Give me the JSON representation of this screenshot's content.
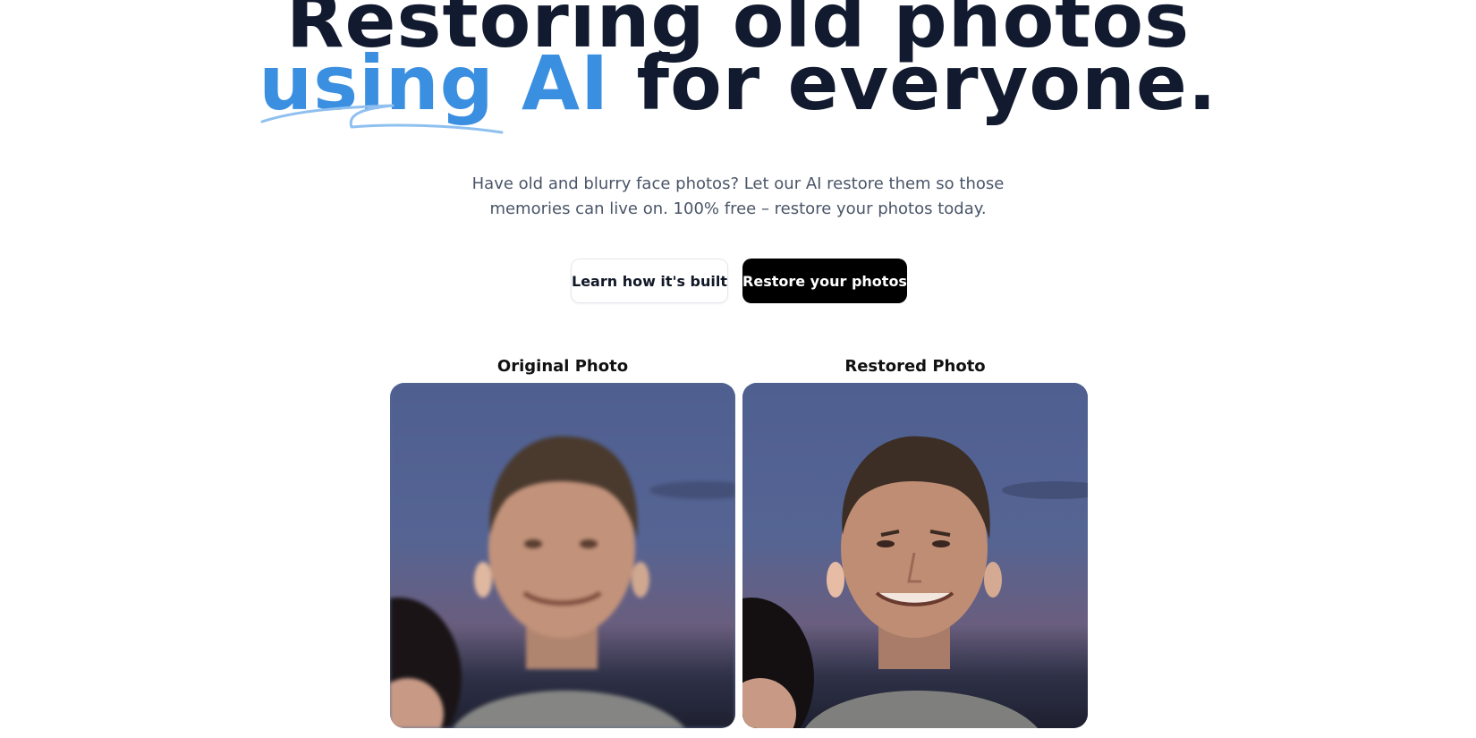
{
  "hero": {
    "title_line1": "Restoring old photos",
    "title_accent": "using AI",
    "title_rest": " for everyone.",
    "accent_color": "#3b8fe0",
    "subtitle": "Have old and blurry face photos? Let our AI restore them so those memories can live on. 100% free – restore your photos today."
  },
  "actions": {
    "learn_label": "Learn how it's built",
    "restore_label": "Restore your photos"
  },
  "comparison": {
    "original_label": "Original Photo",
    "restored_label": "Restored Photo",
    "original_image": "blurry-face-photo",
    "restored_image": "restored-face-photo"
  }
}
